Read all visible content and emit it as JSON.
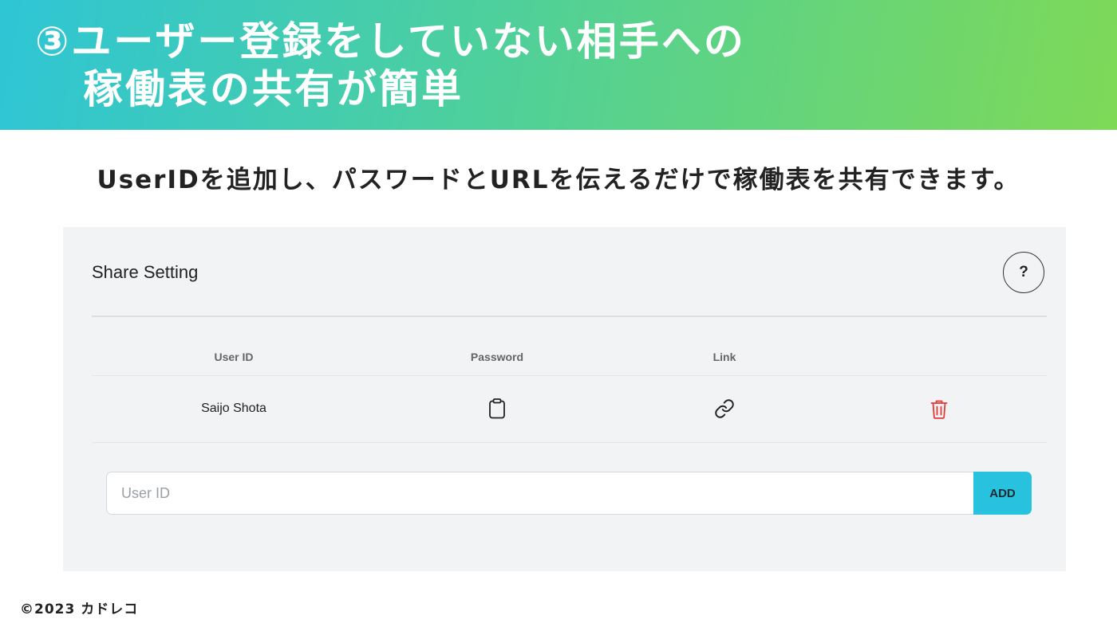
{
  "banner": {
    "title_line1": "③ユーザー登録をしていない相手への",
    "title_line2": "稼働表の共有が簡単",
    "gradient_colors": [
      "#2ec5d6",
      "#4fd09a",
      "#7ed957"
    ]
  },
  "subtitle": "UserIDを追加し、パスワードとURLを伝えるだけで稼働表を共有できます。",
  "panel": {
    "title": "Share Setting",
    "help_label": "?",
    "columns": [
      "User ID",
      "Password",
      "Link"
    ],
    "rows": [
      {
        "user_id": "Saijo Shota",
        "password_icon": "clipboard-icon",
        "link_icon": "link-icon",
        "action_icon": "trash-icon"
      }
    ],
    "input": {
      "placeholder": "User ID",
      "value": ""
    },
    "add_label": "ADD",
    "accent_color": "#29c2de",
    "delete_color": "#e53935"
  },
  "footer": "©2023 カドレコ"
}
